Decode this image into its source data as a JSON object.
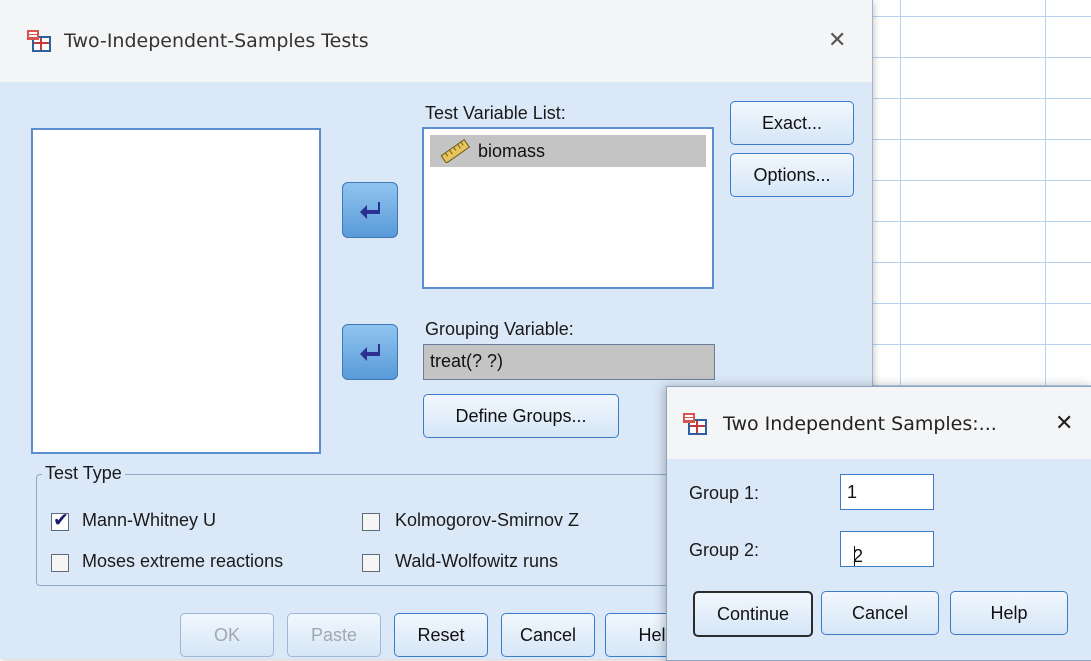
{
  "main_dialog": {
    "title": "Two-Independent-Samples Tests",
    "close_glyph": "✕",
    "test_variable_list_label": "Test Variable List:",
    "test_variables": [
      "biomass"
    ],
    "grouping_variable_label": "Grouping Variable:",
    "grouping_variable_value": "treat(? ?)",
    "define_groups_label": "Define Groups...",
    "exact_label": "Exact...",
    "options_label": "Options...",
    "test_type_legend": "Test Type",
    "tests": [
      {
        "label": "Mann-Whitney U",
        "checked": true
      },
      {
        "label": "Kolmogorov-Smirnov Z",
        "checked": false
      },
      {
        "label": "Moses extreme reactions",
        "checked": false
      },
      {
        "label": "Wald-Wolfowitz runs",
        "checked": false
      }
    ],
    "buttons": {
      "ok": "OK",
      "paste": "Paste",
      "reset": "Reset",
      "cancel": "Cancel",
      "help": "Hel"
    }
  },
  "sub_dialog": {
    "title": "Two Independent Samples:...",
    "close_glyph": "✕",
    "group1_label": "Group 1:",
    "group1_value": "1",
    "group2_label": "Group 2:",
    "group2_value": "2",
    "continue_label": "Continue",
    "cancel_label": "Cancel",
    "help_label": "Help"
  },
  "icons": {
    "app_icon": "spss-dialog-icon",
    "scale_variable_icon": "ruler-icon",
    "move_arrow_icon": "arrow-left-icon"
  },
  "colors": {
    "dialog_bg": "#dbe8f8",
    "accent_border": "#3b7bc8",
    "arrow_button": "#5a9ad9"
  }
}
